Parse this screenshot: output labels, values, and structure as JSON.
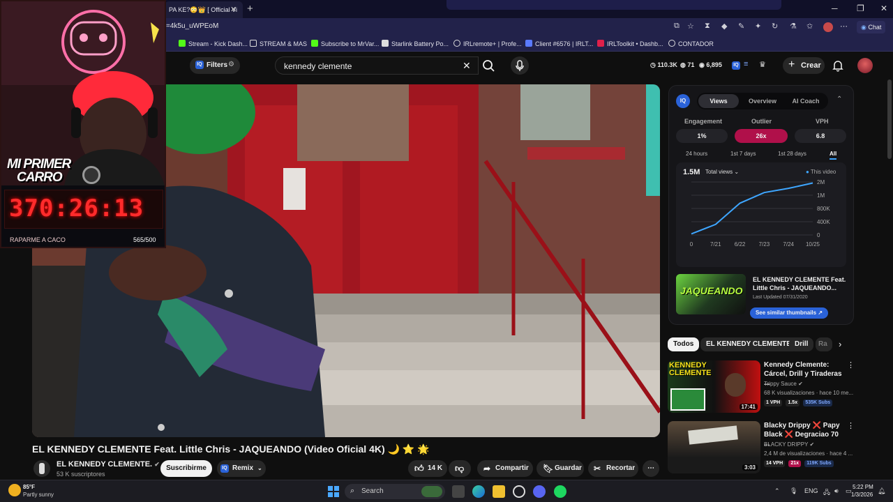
{
  "browser": {
    "tab_title": "PA KE?😳👑 [ Official Vi",
    "url": "=4k5u_uWPEoM",
    "chat_label": "Chat",
    "bookmarks": [
      "Stream - Kick Dash...",
      "STREAM & MAS",
      "Subscribe to MrVar...",
      "Starlink Battery Po...",
      "IRLremote+ | Profe...",
      "Client #6576 | IRLT...",
      "IRLToolkit • Dashb...",
      "CONTADOR"
    ]
  },
  "header": {
    "filters_label": "Filters",
    "search_value": "kennedy clemente",
    "stats": [
      "110.3K",
      "71",
      "6,895"
    ],
    "create_label": "Crear"
  },
  "overlay": {
    "banner_line1": "MI PRIMER",
    "banner_line2": "CARRO",
    "timer": "370:26:13",
    "goal_label": "RAPARME A CACO",
    "goal_count": "565/500"
  },
  "video": {
    "title": "EL KENNEDY CLEMENTE Feat. Little Chris - JAQUEANDO (Video Oficial 4K) 🌙 ⭐ 🌟",
    "channel": "EL KENNEDY CLEMENTE.",
    "subscribers": "53 K suscriptores",
    "subscribe_label": "Suscribirme",
    "remix_label": "Remix",
    "likes": "14 K",
    "share_label": "Compartir",
    "save_label": "Guardar",
    "clip_label": "Recortar"
  },
  "vidiq": {
    "tabs": [
      "Views",
      "Overview",
      "AI Coach"
    ],
    "metrics": [
      {
        "label": "Engagement",
        "value": "1%"
      },
      {
        "label": "Outlier",
        "value": "26x"
      },
      {
        "label": "VPH",
        "value": "6.8"
      }
    ],
    "ranges": [
      "24 hours",
      "1st 7 days",
      "1st 28 days",
      "All"
    ],
    "active_range": "All",
    "total_value": "1.5M",
    "total_select": "Total views",
    "legend": "This video",
    "thumb_title": "EL KENNEDY CLEMENTE Feat. Little Chris - JAQUEANDO...",
    "last_updated": "Last Updated 07/31/2020",
    "similar_btn": "See similar thumbnails",
    "thumb_overlay_text": "JAQUEANDO",
    "accent": "#3ea6ff",
    "outlier_color": "#b0104a"
  },
  "chart_data": {
    "type": "line",
    "x": [
      "0",
      "7/21",
      "6/22",
      "7/23",
      "7/24",
      "10/25"
    ],
    "y_ticks": [
      "0",
      "400K",
      "800K",
      "1M",
      "2M"
    ],
    "series": [
      {
        "name": "This video",
        "values": [
          0.02,
          0.2,
          0.6,
          0.8,
          0.88,
          0.98
        ]
      }
    ]
  },
  "chips": [
    "Todos",
    "EL KENNEDY CLEMENTE.",
    "Drill",
    "Ra"
  ],
  "recommendations": [
    {
      "title": "Kennedy Clemente: Cárcel, Drill y Tiraderas ...",
      "channel": "Trippy Sauce",
      "meta": "68 K visualizaciones · hace 10 me...",
      "duration": "17:41",
      "badges": [
        "1 VPH",
        "1.5x",
        "535K Subs"
      ],
      "thumb_text": "KENNEDY CLEMENTE"
    },
    {
      "title": "Blacky Drippy ❌ Papy Black ❌ Degraciao 70 ...",
      "channel": "BLACKY DRIPPY",
      "meta": "2,4 M de visualizaciones · hace 4 ...",
      "duration": "3:03",
      "badges": [
        "14 VPH",
        "21x",
        "119K Subs"
      ]
    }
  ],
  "taskbar": {
    "temp": "85°F",
    "weather": "Partly sunny",
    "search": "Search",
    "lang": "ENG",
    "time": "5:22 PM",
    "date": "1/3/2026"
  }
}
